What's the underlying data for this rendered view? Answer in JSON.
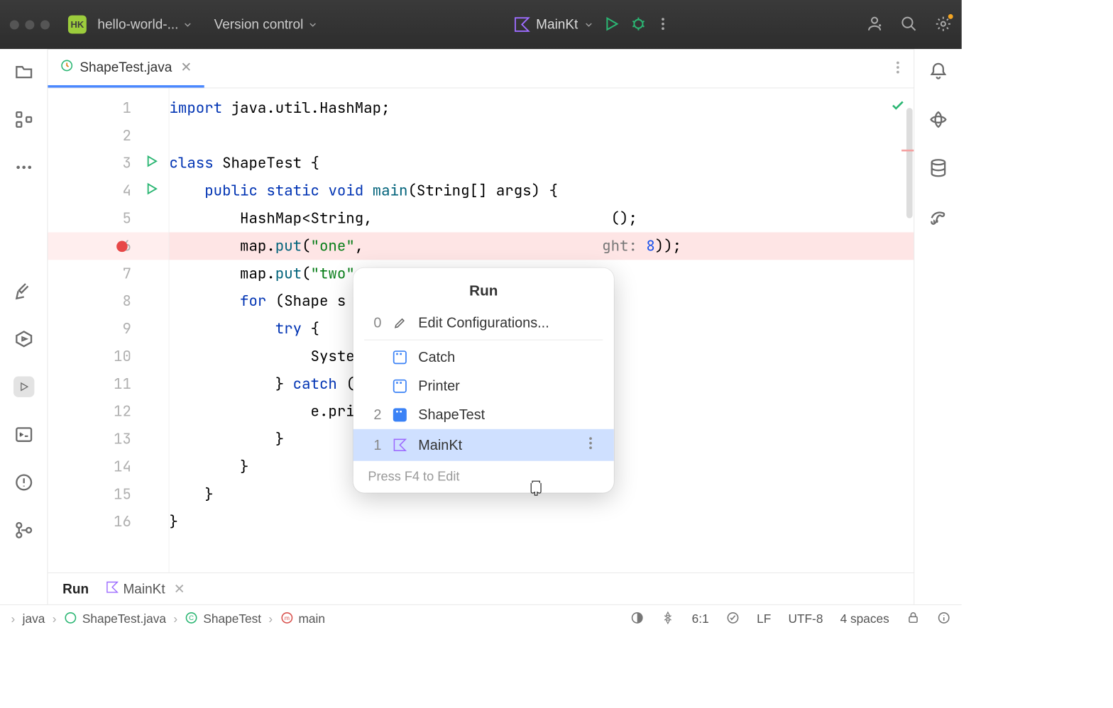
{
  "titlebar": {
    "project_badge": "HK",
    "project_name": "hello-world-...",
    "vcs_label": "Version control",
    "run_config": "MainKt"
  },
  "tab": {
    "filename": "ShapeTest.java"
  },
  "code": {
    "lines": [
      {
        "n": "1"
      },
      {
        "n": "2"
      },
      {
        "n": "3"
      },
      {
        "n": "4"
      },
      {
        "n": "5"
      },
      {
        "n": "6"
      },
      {
        "n": "7"
      },
      {
        "n": "8"
      },
      {
        "n": "9"
      },
      {
        "n": "10"
      },
      {
        "n": "11"
      },
      {
        "n": "12"
      },
      {
        "n": "13"
      },
      {
        "n": "14"
      },
      {
        "n": "15"
      },
      {
        "n": "16"
      }
    ],
    "l1_a": "import",
    "l1_b": " java.util.HashMap;",
    "l3_a": "class",
    "l3_b": " ShapeTest {",
    "l4_a": "public",
    "l4_b": "static",
    "l4_c": "void",
    "l4_d": "main",
    "l4_e": "(String[] args) {",
    "l5_a": "HashMap<String,",
    "l5_b": "();",
    "l6_a": "map.",
    "l6_b": "put",
    "l6_c": "(",
    "l6_str": "\"one\"",
    "l6_d": ",",
    "l6_e": "ght: ",
    "l6_num": "8",
    "l6_f": "));",
    "l7_a": "map.",
    "l7_b": "put",
    "l7_c": "(",
    "l7_str": "\"two\"",
    "l7_d": ",",
    "l8_a": "for",
    "l8_b": " (Shape s :",
    "l9_a": "try",
    "l9_b": " {",
    "l10_a": "System.",
    "l11_a": "} ",
    "l11_b": "catch",
    "l11_c": " (Il",
    "l12_a": "e.print",
    "l13_a": "}",
    "l14_a": "}",
    "l15_a": "}",
    "l16_a": "}"
  },
  "popup": {
    "title": "Run",
    "edit_key": "0",
    "edit_label": "Edit Configurations...",
    "shapetest_key": "2",
    "mainkt_key": "1",
    "items": {
      "catch": "Catch",
      "printer": "Printer",
      "shapetest": "ShapeTest",
      "mainkt": "MainKt"
    },
    "footer": "Press F4 to Edit"
  },
  "bottom": {
    "run_label": "Run",
    "config_name": "MainKt"
  },
  "status": {
    "crumb1": "java",
    "crumb2": "ShapeTest.java",
    "crumb3": "ShapeTest",
    "crumb4": "main",
    "pos": "6:1",
    "lf": "LF",
    "enc": "UTF-8",
    "indent": "4 spaces"
  }
}
